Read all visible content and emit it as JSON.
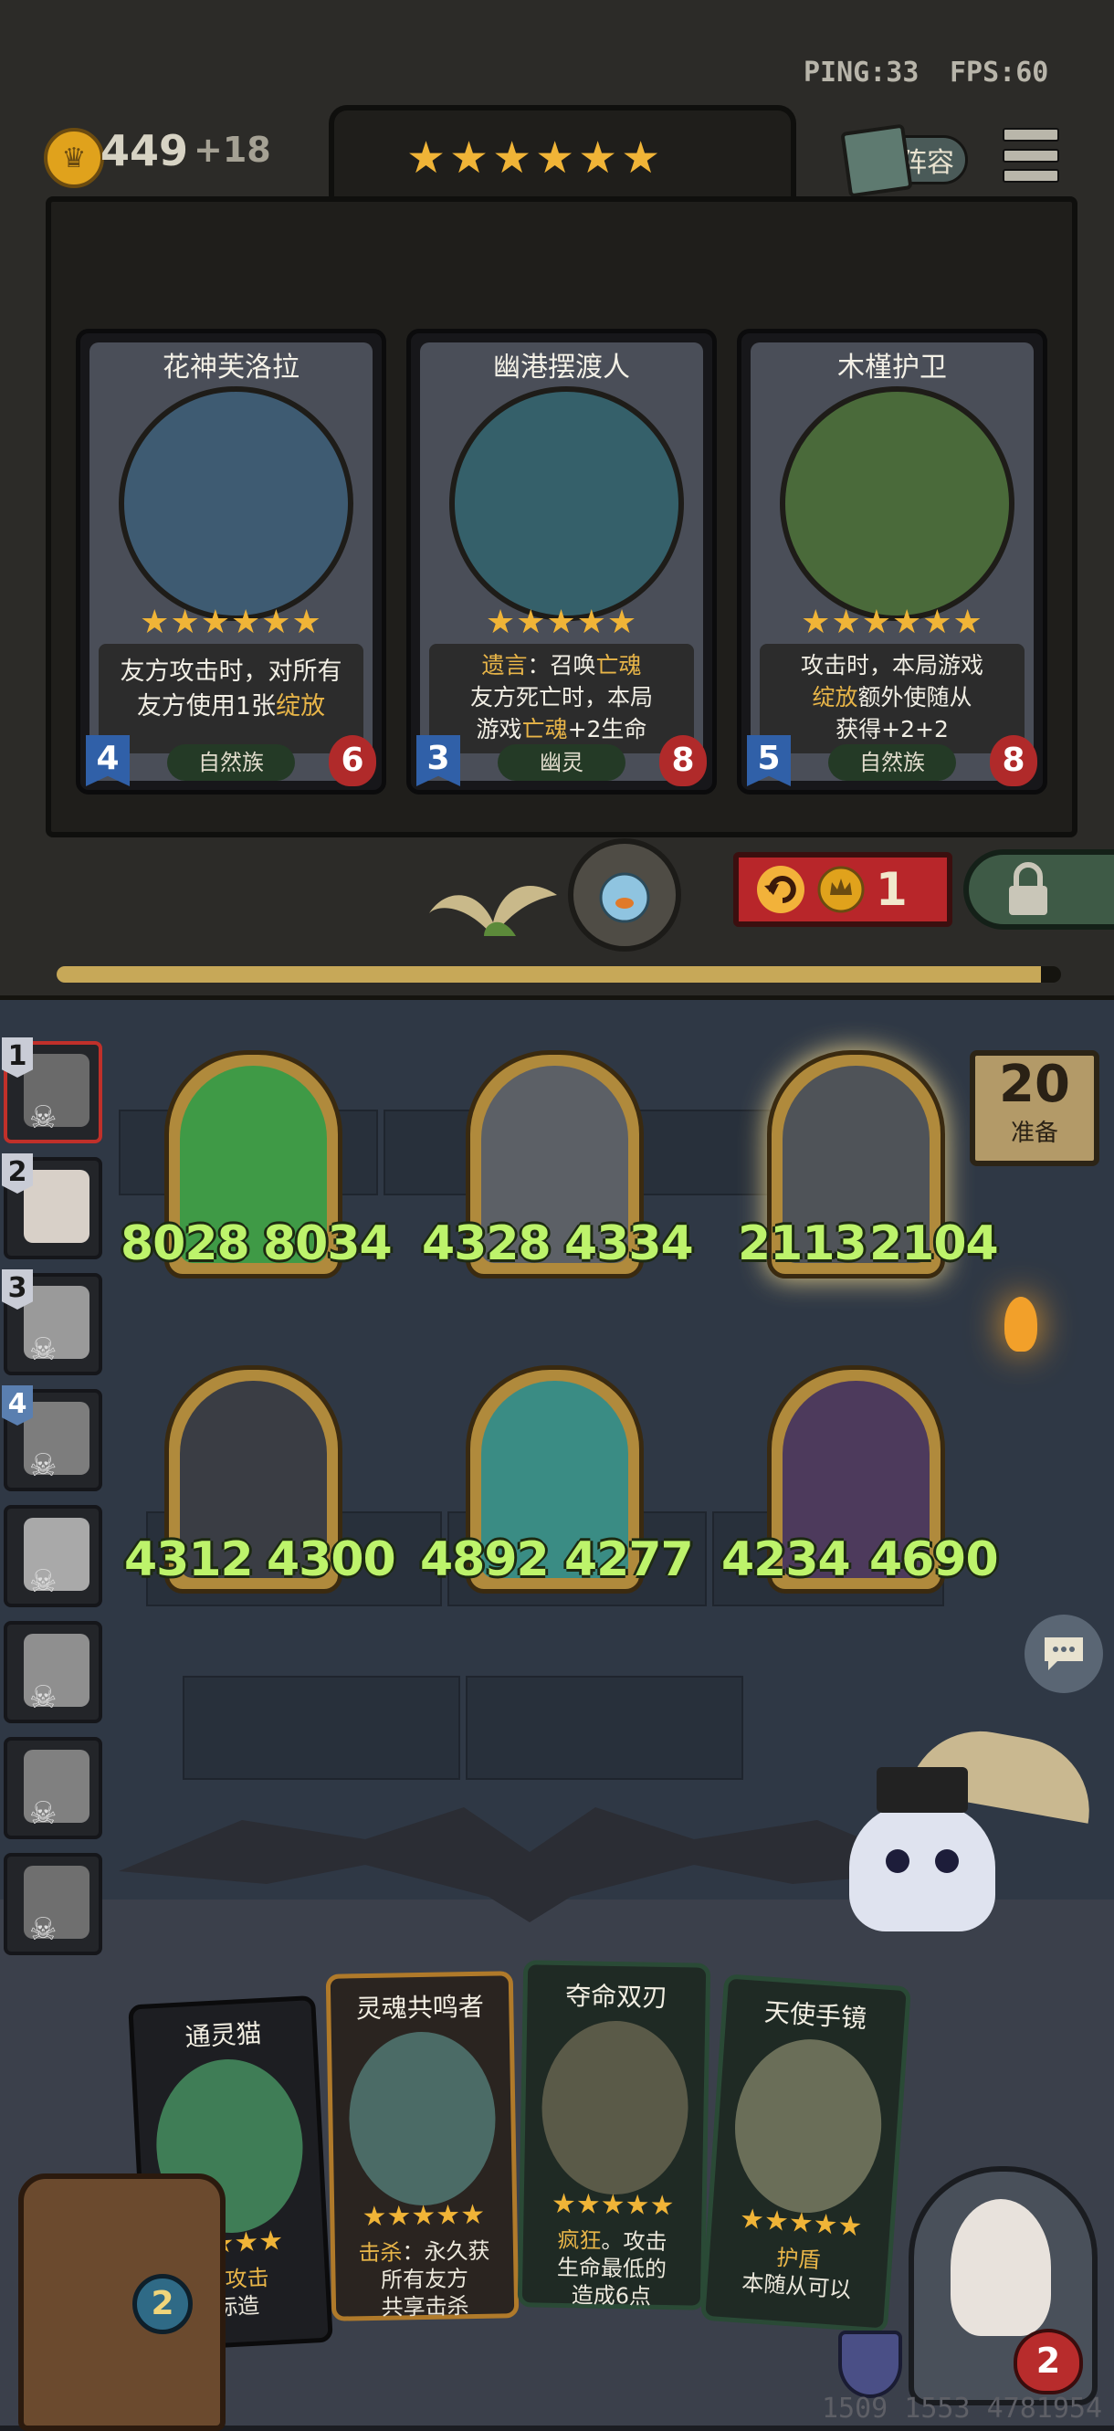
{
  "hud": {
    "ping_label": "PING:33",
    "fps_label": "FPS:60",
    "gold": "449",
    "gold_income": "+18",
    "tavern_stars": "★★★★★★",
    "lineup_label": "阵容"
  },
  "shop_cards": [
    {
      "name": "花神芙洛拉",
      "stars": "★★★★★★",
      "desc_line1": "友方攻击时，对所有",
      "desc_line2_plain": "友方使用1张",
      "desc_line2_kw": "绽放",
      "attack": "4",
      "health": "6",
      "tribe": "自然族",
      "art_color": "#3e5b72"
    },
    {
      "name": "幽港摆渡人",
      "stars": "★★★★★",
      "desc_line1_kw": "遗言",
      "desc_line1_plain": "：召唤",
      "desc_line1_kw2": "亡魂",
      "desc_line2": "友方死亡时，本局",
      "desc_line3_plain": "游戏",
      "desc_line3_kw": "亡魂",
      "desc_line3_tail": "+2生命",
      "attack": "3",
      "health": "8",
      "tribe": "幽灵",
      "art_color": "#35606a"
    },
    {
      "name": "木槿护卫",
      "stars": "★★★★★★",
      "desc_line1": "攻击时，本局游戏",
      "desc_line2_kw": "绽放",
      "desc_line2_plain": "额外使随从",
      "desc_line3": "获得+2+2",
      "attack": "5",
      "health": "8",
      "tribe": "自然族",
      "art_color": "#4a6a3a"
    }
  ],
  "shop_controls": {
    "refresh_cost": "1",
    "progress_fraction": 0.98
  },
  "sidebar": [
    {
      "rank": "1",
      "color": "#6a6a6a"
    },
    {
      "rank": "2",
      "color": "#d8d0c8"
    },
    {
      "rank": "3",
      "color": "#9a9a9a"
    },
    {
      "rank": "4",
      "color": "#7d7d7d"
    },
    {
      "rank": "",
      "color": "#a9a9a9"
    },
    {
      "rank": "",
      "color": "#8f8f8f"
    },
    {
      "rank": "",
      "color": "#808080"
    },
    {
      "rank": "",
      "color": "#6f6f6f"
    }
  ],
  "board": {
    "turn_number": "20",
    "turn_label": "准备",
    "row1": [
      {
        "attack": "8028",
        "health": "8034",
        "color": "#3f9a46"
      },
      {
        "attack": "4328",
        "health": "4334",
        "color": "#5c6066"
      },
      {
        "attack": "2113",
        "health": "2104",
        "color": "#4f5358"
      }
    ],
    "row2": [
      {
        "attack": "4312",
        "health": "4300",
        "color": "#3a3d44"
      },
      {
        "attack": "4892",
        "health": "4277",
        "color": "#3a8c84"
      },
      {
        "attack": "4234",
        "health": "4690",
        "color": "#4d3a5c"
      }
    ]
  },
  "hand": [
    {
      "name": "通灵猫",
      "desc1": "灵攻击",
      "desc2": "标造",
      "color": "#3f7d56"
    },
    {
      "name": "灵魂共鸣者",
      "desc1_kw": "击杀",
      "desc1_plain": "：永久获",
      "desc2": "所有友方",
      "desc3": "共享击杀",
      "color": "#4b6b66"
    },
    {
      "name": "夺命双刃",
      "desc1_kw": "疯狂",
      "desc1_plain": "。攻击",
      "desc2": "生命最低的",
      "desc3": "造成6点",
      "color": "#5a5a48"
    },
    {
      "name": "天使手镜",
      "desc1_kw": "护盾",
      "desc2": "本随从可以",
      "color": "#6a6e58"
    }
  ],
  "hand_stars": [
    "★★★★",
    "★★★★★",
    "★★★★★",
    "★★★★★"
  ],
  "bottom": {
    "shop_badge": "2",
    "hero_health": "2",
    "player_id": "1509 1553 4781954"
  },
  "colors": {
    "stat_green": "#bdf36b",
    "gold": "#f0b437",
    "keyword": "#e8b548"
  }
}
